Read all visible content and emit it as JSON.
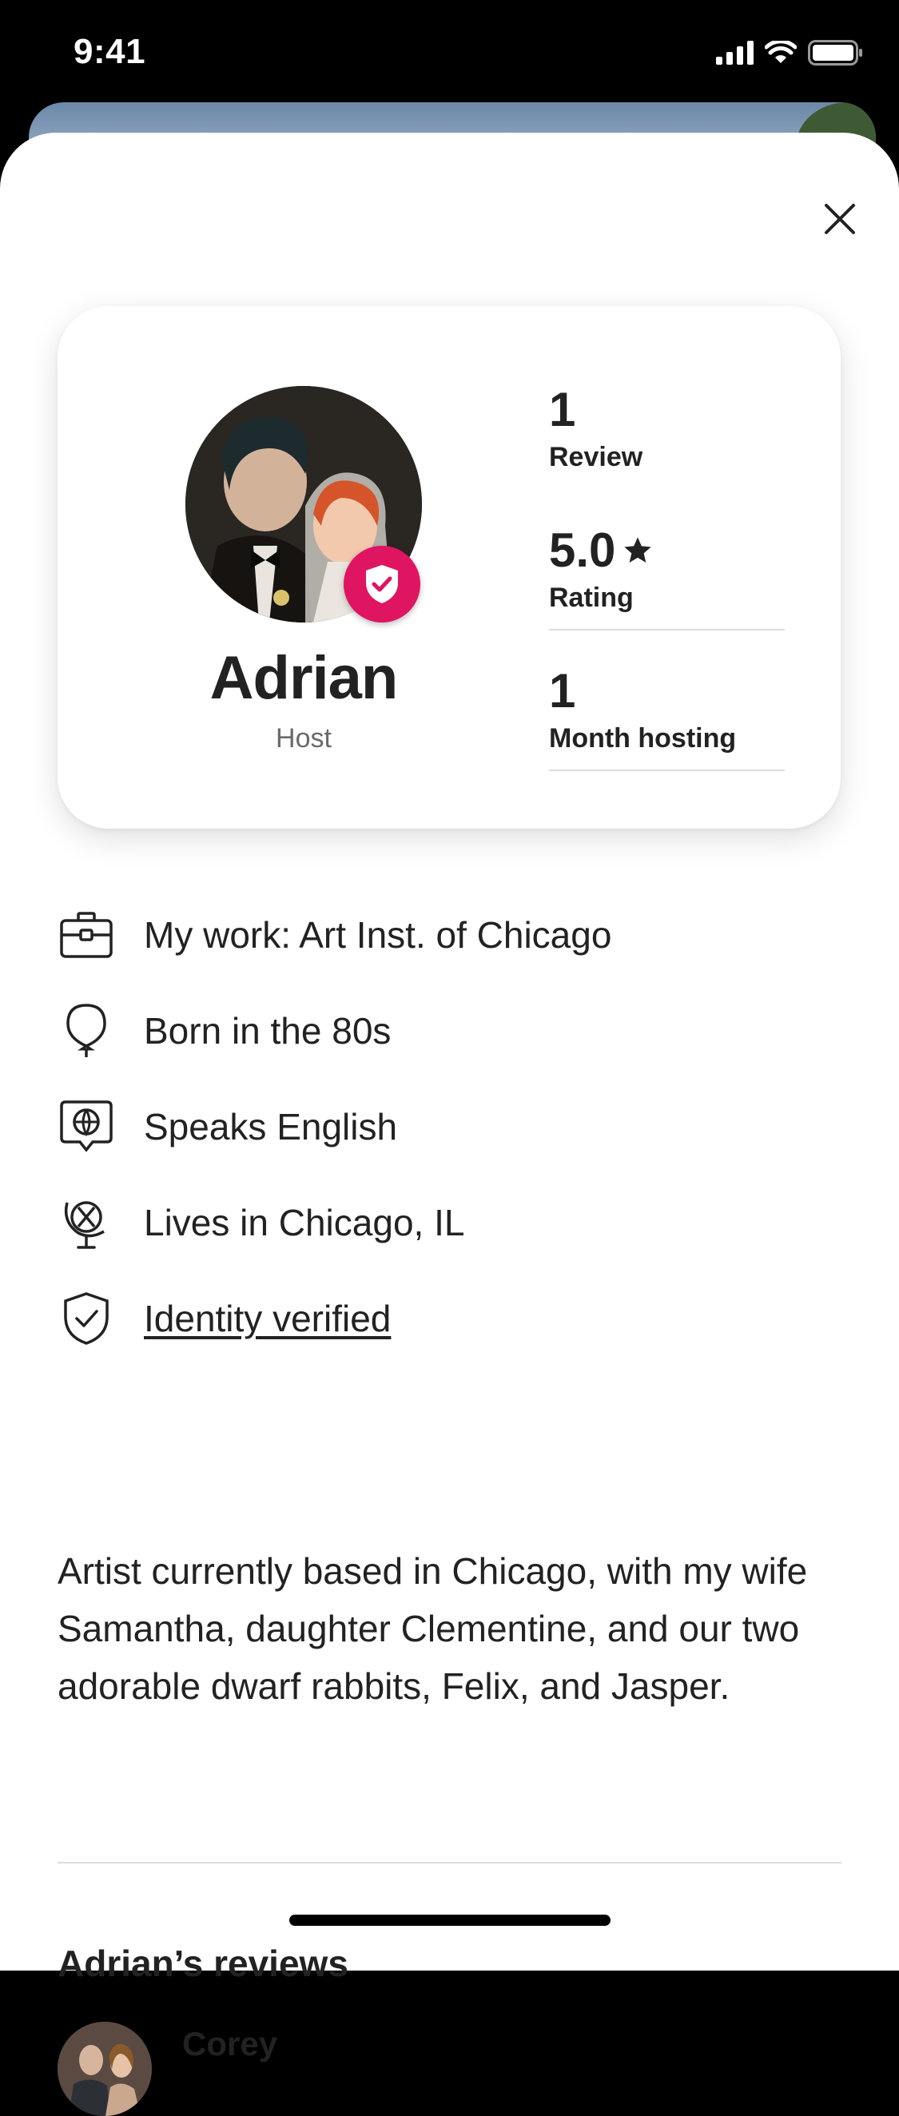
{
  "status_bar": {
    "time": "9:41"
  },
  "profile": {
    "name": "Adrian",
    "role": "Host",
    "stats": [
      {
        "value": "1",
        "label": "Review"
      },
      {
        "value": "5.0",
        "label": "Rating",
        "icon": "star-icon"
      },
      {
        "value": "1",
        "label": "Month hosting"
      }
    ]
  },
  "details": [
    {
      "icon": "briefcase-icon",
      "text": "My work: Art Inst. of Chicago"
    },
    {
      "icon": "balloon-icon",
      "text": "Born in the 80s"
    },
    {
      "icon": "speech-globe-icon",
      "text": "Speaks English"
    },
    {
      "icon": "globe-stand-icon",
      "text": "Lives in Chicago, IL"
    },
    {
      "icon": "shield-check-icon",
      "text": "Identity verified"
    }
  ],
  "about": "Artist currently based in Chicago, with my wife Samantha, daughter Clementine, and our two adorable dwarf rabbits, Felix, and Jasper.",
  "reviews": {
    "heading": "Adrian’s reviews",
    "items": [
      {
        "reviewer": "Corey"
      }
    ]
  },
  "colors": {
    "accent": "#E01561",
    "text": "#222222",
    "secondary_text": "#6A6A6A",
    "divider": "#DDDDDD"
  }
}
